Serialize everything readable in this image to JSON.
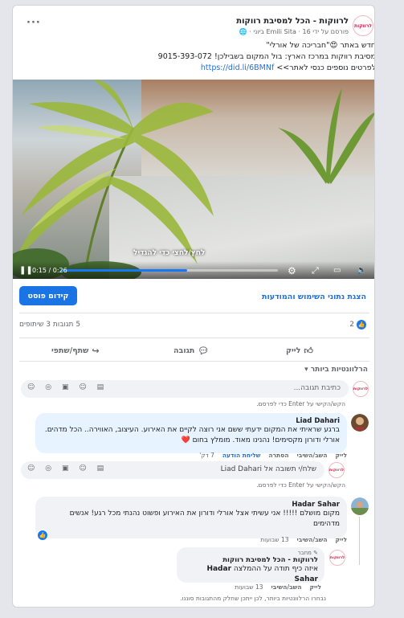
{
  "post": {
    "page_name": "לרווקות - הכל למסיבת רווקות",
    "meta": "פורסם על ידי Emili Sita · 16 ביוני · ",
    "more": "···",
    "lines": [
      "חדש באתר 😍\"חבריכה של אורלי\"",
      "מסיבת רווקות במרכז הארץ: בול המקום בשבילכן! 9015-393-072"
    ],
    "line3_prefix": "לפרטים נוספים כנסי לאתר>> ",
    "link": "https://did.li/6BMNf"
  },
  "video": {
    "caption": "לחץ/לחצי כדי להגדיל",
    "time": "0:15 / 0:26",
    "progress": 0.58,
    "controls": {
      "play": "❚❚",
      "settings": "⚙",
      "expand": "⤢",
      "pip": "▭",
      "volume": "🔈"
    }
  },
  "promote": {
    "button": "קידום פוסט",
    "insights": "הצגת נתוני השימוש והמודעות"
  },
  "stats": {
    "likes": "2",
    "comments_shares": "5 תגובות  3 שיתופים"
  },
  "actions": {
    "like": "לייק",
    "comment": "תגובה",
    "share": "שתף/שתפי"
  },
  "filter": "הרלוונטיות ביותר ▾",
  "composer": {
    "placeholder": "כתיבת תגובה...",
    "hint": "הקש/הקישי על Enter כדי לפרסם.",
    "icons": "☺ ◎ ▣ ☺ ▤"
  },
  "comments": [
    {
      "author": "Liad Dahari",
      "text": "ברגע שראיתי את המקום ידעתי ששם אני רוצה לקיים את האירוע. העיצוב, האווירה.. הכל מדהים. אורלי ודורון מקסימים! נהנינו מאוד. מומלץ בחום ❤️",
      "actions": [
        "לייק",
        "השב/השיבי",
        "הסתרה"
      ],
      "extra": "שליחת הודעה",
      "time": "7 דק'"
    },
    {
      "author": "Hadar Sahar",
      "text": "מקום מושלם !!!!! אני עשיתי אצל אורלי ודורון את האירוע ופשוט נהנתי מכל רגע! אנשים מדהימים",
      "actions": [
        "לייק",
        "השב/השיבי"
      ],
      "time": "13 שבועות"
    }
  ],
  "reply_box": {
    "placeholder": "שלח/י תשובה אל Liad Dahari",
    "hint": "הקש/הקישי על Enter כדי לפרסם."
  },
  "page_reply": {
    "badge": "✎ מחבר",
    "author": "לרווקות - הכל למסיבת רווקות",
    "text_prefix": "איזה כיף תודה על ההמלצה ",
    "text_name": "Hadar Sahar",
    "actions": [
      "לייק",
      "השב/השיבי"
    ],
    "time": "13 שבועות"
  },
  "footer_note": "נבחרו הרלוונטיות ביותר, לכן ייתכן שחלק מהתגובות סוננו.",
  "colors": {
    "accent": "#1877f2",
    "link": "#216fdb",
    "bg": "#e4e6eb"
  }
}
